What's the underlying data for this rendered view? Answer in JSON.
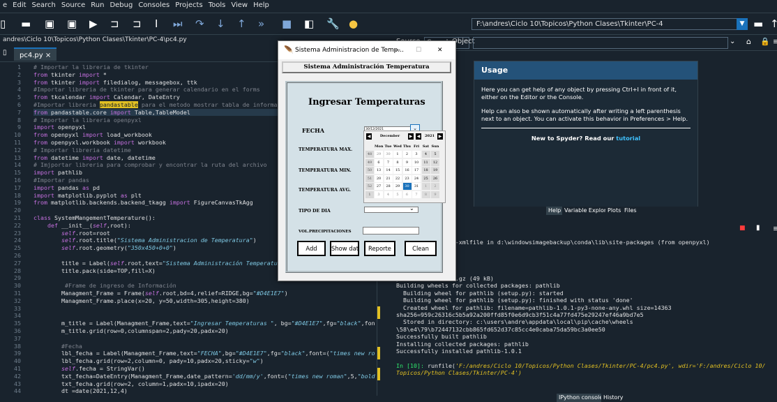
{
  "menubar": [
    "e",
    "Edit",
    "Search",
    "Source",
    "Run",
    "Debug",
    "Consoles",
    "Projects",
    "Tools",
    "View",
    "Help"
  ],
  "toolbar": {
    "path": "F:\\andres\\Ciclo 10\\Topicos\\Python Clases\\Tkinter\\PC-4"
  },
  "editor": {
    "file_path": "andres\\Ciclo 10\\Topicos\\Python Clases\\Tkinter\\PC-4\\pc4.py",
    "tab_label": "pc4.py",
    "tab_close": "×",
    "line_numbers": [
      "1",
      "2",
      "3",
      "4",
      "5",
      "6",
      "7",
      "8",
      "9",
      "10",
      "11",
      "12",
      "13",
      "14",
      "15",
      "16",
      "17",
      "18",
      "19",
      "20",
      "21",
      "22",
      "23",
      "24",
      "25",
      "26",
      "27",
      "28",
      "29",
      "30",
      "31",
      "32",
      "33",
      "34",
      "35",
      "36",
      "37",
      "38",
      "39",
      "40",
      "41",
      "42",
      "43",
      "44"
    ],
    "lines": [
      "# Importar la libreria de tkinter",
      "from tkinter import *",
      "from tkinter import filedialog, messagebox, ttk",
      "#Importar libreria de tkinter para generar calendario en el forms",
      "from tkcalendar import Calendar, DateEntry",
      "#Importar libreria pandastable para el metodo mostrar tabla de informac",
      "from pandastable.core import Table,TableModel",
      "# Importar la libreria openpyxl",
      "import openpyxl",
      "from openpyxl import load_workbook",
      "from openpyxl.workbook import workbook",
      "# Importar libreria datetime",
      "from datetime import date, datetime",
      "# Imjportar libreria para comprobar y encontrar la ruta del archivo",
      "import pathlib",
      "#Importar pandas",
      "import pandas as pd",
      "import matplotlib.pyplot as plt",
      "from matplotlib.backends.backend_tkagg import FigureCanvasTkAgg",
      "",
      "class SystemMangementTemperature():",
      "    def __init__(self,root):",
      "        self.root=root",
      "        self.root.title(\"Sistema Administracion de Temperatura\")",
      "        self.root.geometry(\"350x450+0+0\")",
      "",
      "        title = Label(self.root,text=\"Sistema Administración Temperatur",
      "        title.pack(side=TOP,fill=X)",
      "",
      "         #Frame de ingreso de Información",
      "        Managment_Frame = Frame(self.root,bd=4,relief=RIDGE,bg=\"#D4E1E7\")",
      "        Managment_Frame.place(x=20, y=50,width=305,height=380)",
      "",
      "",
      "        m_title = Label(Managment_Frame,text=\"Ingresar Temperaturas \", bg=\"#D4E1E7\",fg=\"black\",fon",
      "        m_title.grid(row=0,columnspan=2,pady=20,padx=20)",
      "",
      "        #Fecha",
      "        lbl_fecha = Label(Managment_Frame,text=\"FECHA\",bg=\"#D4E1E7\",fg=\"black\",font=(\"times new ro",
      "        lbl_fecha.grid(row=2,column=0, pady=10,padx=20,sticky=\"w\")",
      "        self.fecha = StringVar()",
      "        txt_fecha=DateEntry(Managment_Frame,date_pattern='dd/mm/y',font=(\"times new roman\",5,\"bold",
      "        txt_fecha.grid(row=2, column=1,padx=10,ipadx=20)",
      "        dt =date(2021,12,4)"
    ]
  },
  "object_bar": {
    "source_label": "Source",
    "console_label": "Console",
    "object_label": "Object"
  },
  "help": {
    "title": "Usage",
    "p1": "Here you can get help of any object by pressing Ctrl+I in front of it, either on the Editor or the Console.",
    "p2": "Help can also be shown automatically after writing a left parenthesis next to an object. You can activate this behavior in Preferences > Help.",
    "new_prefix": "New to Spyder? Read our ",
    "new_link": "tutorial"
  },
  "help_tabs": [
    "Help",
    "Variable Explorer",
    "Plots",
    "Files"
  ],
  "console": {
    "lines": [
      "ady satisfied: et-xmlfile in d:\\windowsimagebackup\\conda\\lib\\site-packages (from openpyxl)",
      "",
      "",
      "tall pathlib",
      "ib",
      "pathlib-1.0.1.tar.gz (49 kB)",
      "Building wheels for collected packages: pathlib",
      "  Building wheel for pathlib (setup.py): started",
      "  Building wheel for pathlib (setup.py): finished with status 'done'",
      "  Created wheel for pathlib: filename=pathlib-1.0.1-py3-none-any.whl size=14363",
      "sha256=959c26316c5b5a92a200ffd85f0e6d9cb3f51c4a77fd475e29247ef46a9bd7e5",
      "  Stored in directory: c:\\users\\andre\\appdata\\local\\pip\\cache\\wheels",
      "\\58\\e4\\79\\b72447132cbb865fd652d37c85cc4e0caba75da59bc3a0ee50",
      "Successfully built pathlib",
      "Installing collected packages: pathlib",
      "Successfully installed pathlib-1.0.1",
      "",
      "In [10]: runfile('F:/andres/Ciclo 10/Topicos/Python Clases/Tkinter/PC-4/pc4.py', wdir='F:/andres/Ciclo 10/",
      "Topicos/Python Clases/Tkinter/PC-4')"
    ]
  },
  "console_tabs": [
    "IPython console",
    "History"
  ],
  "tk": {
    "window_title": "Sistema Administracion de Temp...",
    "minimize": "—",
    "maximize": "☐",
    "close": "✕",
    "header": "Sistema Administración Temperatura",
    "frame_title": "Ingresar Temperaturas",
    "lbl_fecha": "FECHA",
    "fecha_value": "30/12/2021",
    "lbl_tmax": "TEMPERATURA MAX.",
    "lbl_tmin": "TEMPERATURA MIN.",
    "lbl_tavg": "TEMPERATURA AVG.",
    "lbl_tipo": "TIPO DE DIA",
    "lbl_vol": "VOL.PRECIPITACIONES",
    "buttons": {
      "add": "Add",
      "show": "Show data",
      "report": "Reporte",
      "clean": "Clean"
    }
  },
  "calendar": {
    "month": "December",
    "year": "2021",
    "weekdays": [
      "Mon",
      "Tue",
      "Wed",
      "Thu",
      "Fri",
      "Sat",
      "Sun"
    ],
    "weeks": [
      {
        "wk": "48",
        "days": [
          "29",
          "30",
          "1",
          "2",
          "3",
          "4",
          "5"
        ]
      },
      {
        "wk": "49",
        "days": [
          "6",
          "7",
          "8",
          "9",
          "10",
          "11",
          "12"
        ]
      },
      {
        "wk": "50",
        "days": [
          "13",
          "14",
          "15",
          "16",
          "17",
          "18",
          "19"
        ]
      },
      {
        "wk": "51",
        "days": [
          "20",
          "21",
          "22",
          "23",
          "24",
          "25",
          "26"
        ]
      },
      {
        "wk": "52",
        "days": [
          "27",
          "28",
          "29",
          "30",
          "31",
          "1",
          "2"
        ]
      },
      {
        "wk": "1",
        "days": [
          "3",
          "4",
          "5",
          "6",
          "7",
          "8",
          "9"
        ]
      }
    ],
    "selected_day": "30"
  },
  "colors": {
    "accent": "#1a72bb",
    "frame_bg": "#D4E1E7",
    "editor_bg": "#19232d"
  }
}
